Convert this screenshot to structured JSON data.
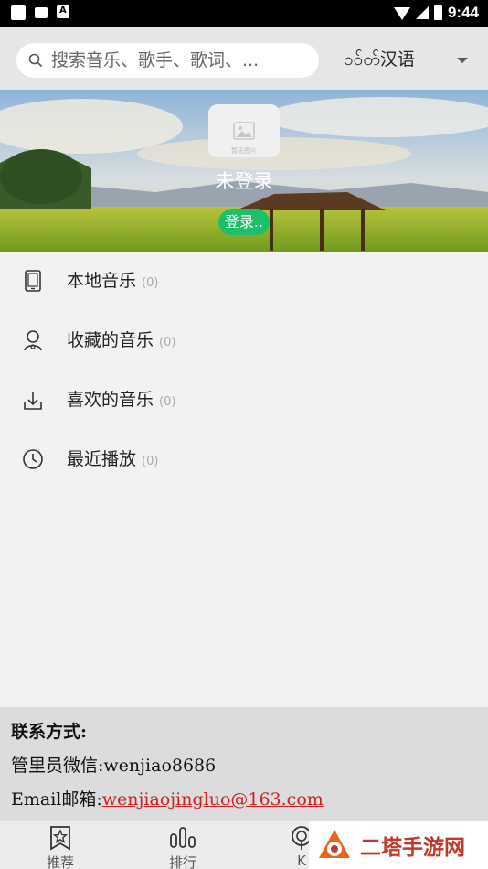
{
  "status_bar": {
    "time": "9:44"
  },
  "search": {
    "placeholder": "搜索音乐、歌手、歌词、..."
  },
  "language": {
    "label": "ဝဝ်တ်汉语"
  },
  "profile": {
    "avatar_caption": "暂无图片",
    "status": "未登录",
    "login_label": "登录.."
  },
  "menu": [
    {
      "label": "本地音乐",
      "count": "(0)",
      "icon": "phone-icon"
    },
    {
      "label": "收藏的音乐",
      "count": "(0)",
      "icon": "user-music-icon"
    },
    {
      "label": "喜欢的音乐",
      "count": "(0)",
      "icon": "download-icon"
    },
    {
      "label": "最近播放",
      "count": "(0)",
      "icon": "clock-icon"
    }
  ],
  "contact": {
    "heading": "联系方式:",
    "wechat_label": "管里员微信:",
    "wechat_value": "wenjiao8686",
    "email_label": "Email邮箱:",
    "email_value": "wenjiaojingluo@163.com"
  },
  "tabs": [
    {
      "label": "推荐",
      "icon": "star-bookmark-icon"
    },
    {
      "label": "排行",
      "icon": "bar-chart-icon"
    },
    {
      "label": "K",
      "icon": "radio-icon"
    }
  ],
  "watermark": {
    "text": "二塔手游网"
  },
  "colors": {
    "accent": "#1cc06a",
    "email_link": "#d21f1f",
    "watermark": "#c0392b"
  }
}
